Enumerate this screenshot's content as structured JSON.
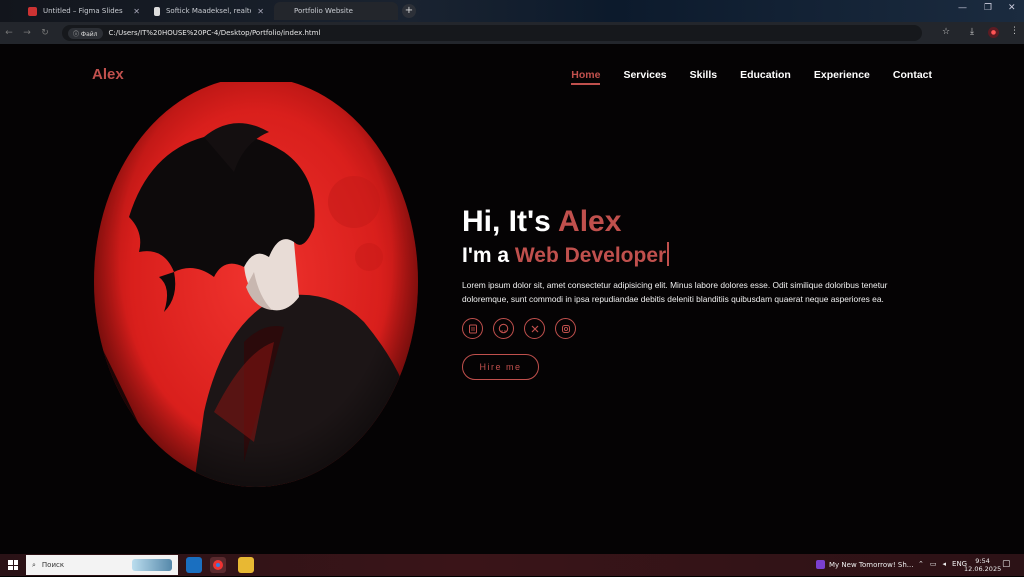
{
  "browser": {
    "tabs": [
      {
        "title": "Untitled – Figma Slides",
        "favicon_color": "#c33"
      },
      {
        "title": "Softick Maadeksel, realtonomprom...",
        "favicon_color": "#ddd"
      },
      {
        "title": "Portfolio Website",
        "favicon_color": "#ddd"
      }
    ],
    "file_chip": "Файл",
    "url": "C:/Users/IT%20HOUSE%20PC-4/Desktop/Portfolio/index.html"
  },
  "site": {
    "logo": "Alex",
    "nav": [
      "Home",
      "Services",
      "Skills",
      "Education",
      "Experience",
      "Contact"
    ],
    "active_nav": "Home",
    "greeting_prefix": "Hi, It's ",
    "greeting_name": "Alex",
    "role_prefix": "I'm a ",
    "role": "Web Developer",
    "bio": "Lorem ipsum dolor sit, amet consectetur adipisicing elit. Minus labore dolores esse. Odit similique doloribus tenetur doloremque, sunt commodi in ipsa repudiandae debitis deleniti blanditiis quibusdam quaerat neque asperiores ea.",
    "socials": [
      "resume-icon",
      "github-icon",
      "x-icon",
      "instagram-icon"
    ],
    "cta": "Hire me",
    "accent_color": "#c0504d"
  },
  "taskbar": {
    "search_placeholder": "Поиск",
    "running_app": "My New Tomorrow! Sh...",
    "language": "ENG",
    "time": "9:54",
    "date": "12.06.2025"
  }
}
